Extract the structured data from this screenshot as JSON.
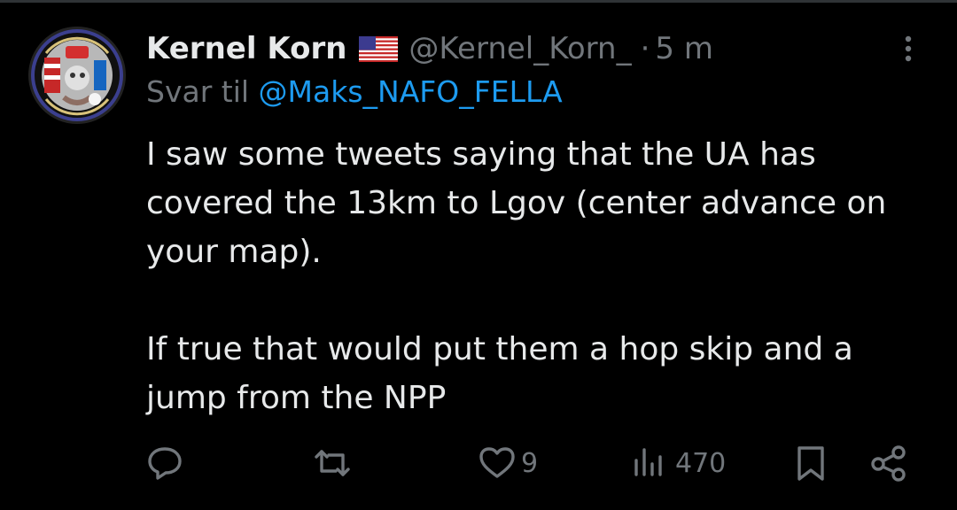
{
  "tweet": {
    "author": {
      "display_name": "Kernel Korn",
      "handle": "@Kernel_Korn_",
      "flag": "us-flag-emoji",
      "avatar": "nafo-kfc-avatar"
    },
    "separator": "·",
    "time": "5 m",
    "reply_to": {
      "prefix": "Svar til",
      "mention": "@Maks_NAFO_FELLA"
    },
    "text": {
      "p1": "I saw some tweets saying that the UA has covered the 13km to Lgov (center advance on your map).",
      "p2": "If true that would put them a hop skip and a jump from the NPP"
    },
    "actions": {
      "reply_icon": "comment-icon",
      "retweet_icon": "retweet-icon",
      "like_icon": "heart-icon",
      "like_count": "9",
      "views_icon": "views-bar-icon",
      "views_count": "470",
      "bookmark_icon": "bookmark-icon",
      "share_icon": "share-icon"
    },
    "more_icon": "more-vertical-icon"
  },
  "colors": {
    "background": "#000000",
    "text": "#e7e9ea",
    "secondary": "#71767b",
    "link": "#1d9bf0"
  }
}
